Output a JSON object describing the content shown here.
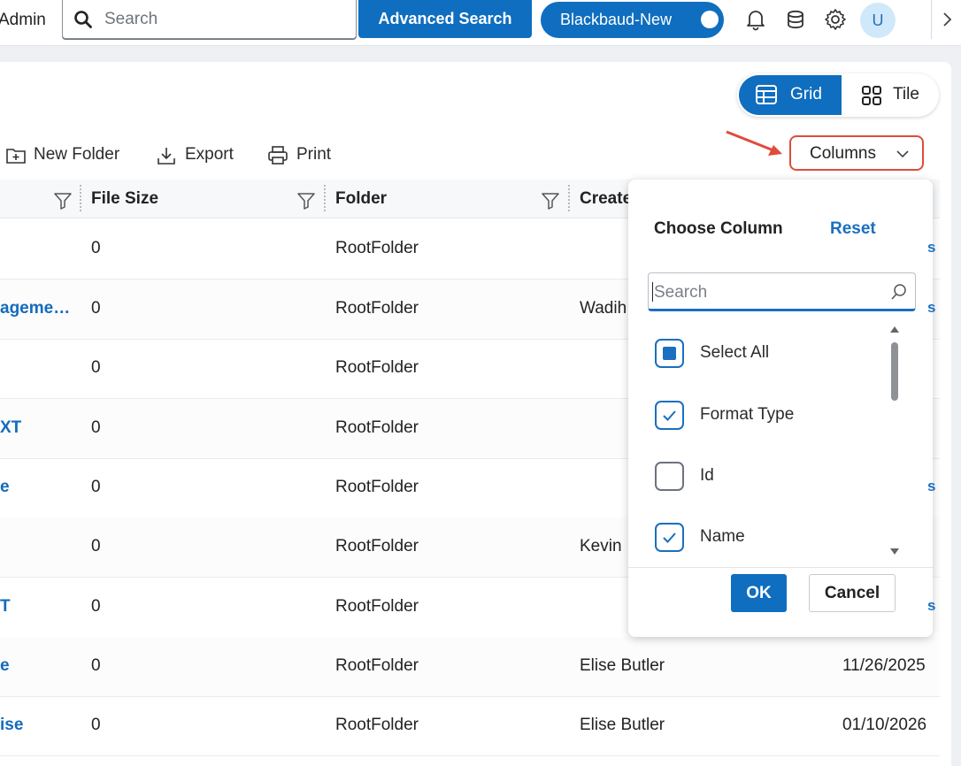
{
  "topbar": {
    "admin_label": "Admin",
    "search_placeholder": "Search",
    "advanced_search_label": "Advanced Search",
    "tenant_label": "Blackbaud-New",
    "avatar_initial": "U"
  },
  "view_toggle": {
    "grid_label": "Grid",
    "tile_label": "Tile",
    "selected": "Grid"
  },
  "toolbar": {
    "new_folder_label": "New Folder",
    "export_label": "Export",
    "print_label": "Print",
    "columns_label": "Columns"
  },
  "grid": {
    "headers": {
      "file_size": "File Size",
      "folder": "Folder",
      "created_by": "Create"
    },
    "rows": [
      {
        "name": "",
        "file_size": "0",
        "folder": "RootFolder",
        "created_by": "",
        "date": ""
      },
      {
        "name": "ageme…",
        "file_size": "0",
        "folder": "RootFolder",
        "created_by": "Wadih",
        "date": ""
      },
      {
        "name": "",
        "file_size": "0",
        "folder": "RootFolder",
        "created_by": "",
        "date": ""
      },
      {
        "name": "XT",
        "file_size": "0",
        "folder": "RootFolder",
        "created_by": "",
        "date": ""
      },
      {
        "name": "e",
        "file_size": "0",
        "folder": "RootFolder",
        "created_by": "",
        "date": ""
      },
      {
        "name": "",
        "file_size": "0",
        "folder": "RootFolder",
        "created_by": "Kevin",
        "date": ""
      },
      {
        "name": "T",
        "file_size": "0",
        "folder": "RootFolder",
        "created_by": "",
        "date": ""
      },
      {
        "name": "e",
        "file_size": "0",
        "folder": "RootFolder",
        "created_by": "Elise Butler",
        "date": "11/26/2025"
      },
      {
        "name": "ise",
        "file_size": "0",
        "folder": "RootFolder",
        "created_by": "Elise Butler",
        "date": "01/10/2026"
      }
    ]
  },
  "column_chooser": {
    "title": "Choose Column",
    "reset_label": "Reset",
    "search_placeholder": "Search",
    "options": [
      {
        "label": "Select All",
        "state": "indeterminate"
      },
      {
        "label": "Format Type",
        "state": "checked"
      },
      {
        "label": "Id",
        "state": "unchecked"
      },
      {
        "label": "Name",
        "state": "checked"
      }
    ],
    "ok_label": "OK",
    "cancel_label": "Cancel"
  },
  "colors": {
    "primary": "#0f6ebf",
    "highlight_border": "#e04b3c",
    "link": "#136bbd"
  }
}
